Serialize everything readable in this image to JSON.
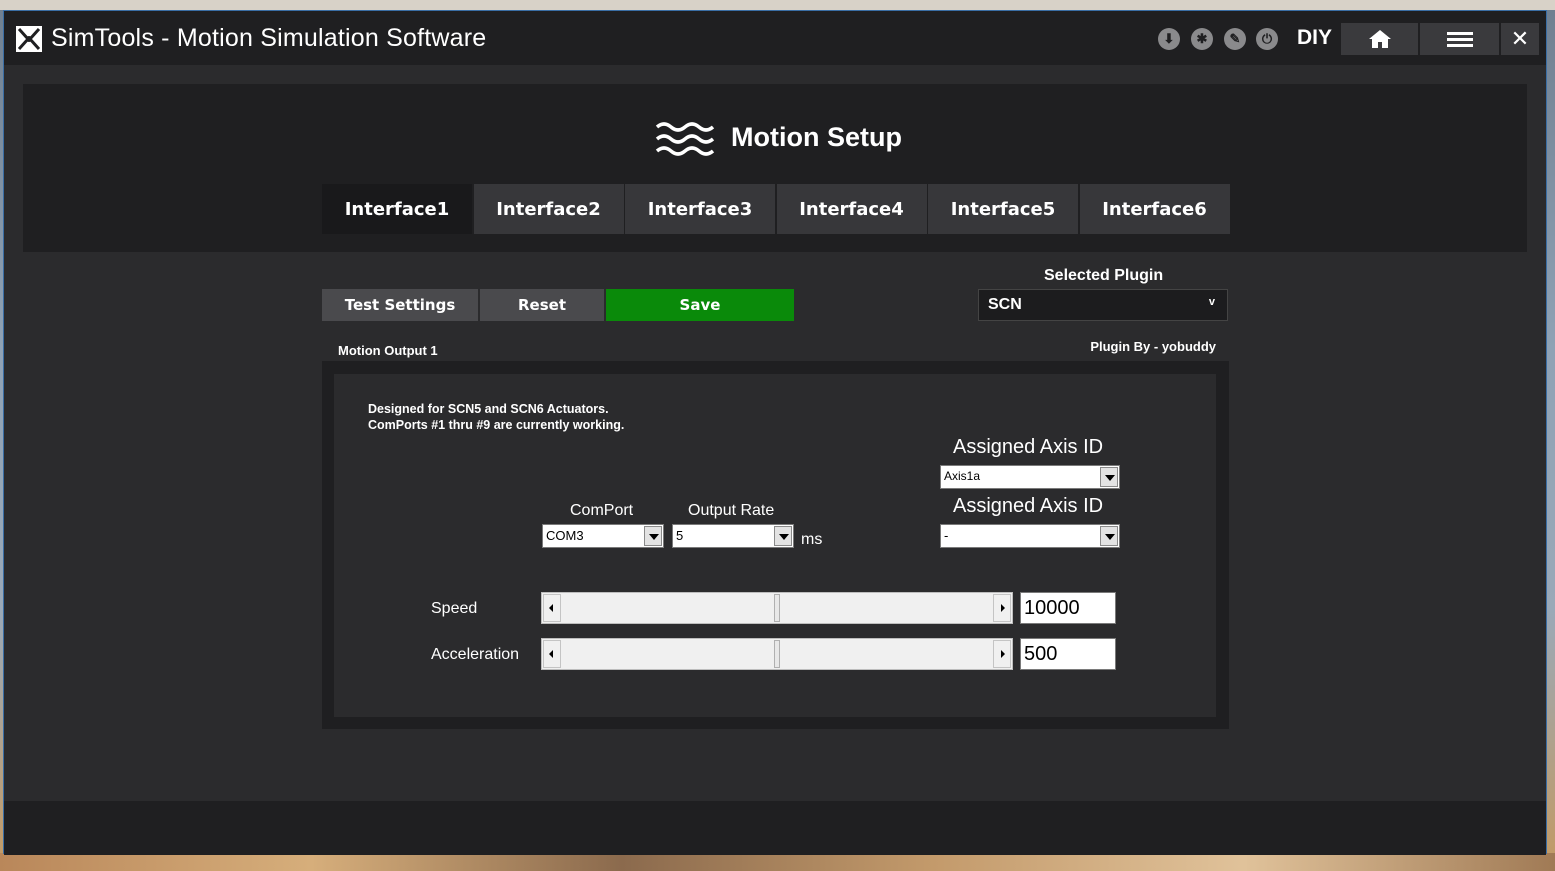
{
  "window": {
    "title": "SimTools - Motion Simulation Software",
    "accent_color": "#3a6ea5"
  },
  "titlebar": {
    "icons": [
      "download-icon",
      "settings-icon",
      "edit-icon",
      "power-icon"
    ],
    "diy_label": "DIY",
    "home_icon": "home-icon",
    "menu_icon": "menu-icon",
    "close_label": "✕"
  },
  "header": {
    "icon": "wave-icon",
    "title": "Motion Setup"
  },
  "tabs": [
    {
      "label": "Interface1",
      "active": true
    },
    {
      "label": "Interface2",
      "active": false
    },
    {
      "label": "Interface3",
      "active": false
    },
    {
      "label": "Interface4",
      "active": false
    },
    {
      "label": "Interface5",
      "active": false
    },
    {
      "label": "Interface6",
      "active": false
    }
  ],
  "toolbar": {
    "test_label": "Test Settings",
    "reset_label": "Reset",
    "save_label": "Save",
    "save_color": "#0a8a0a"
  },
  "plugin": {
    "selected_label": "Selected Plugin",
    "selected_value": "SCN",
    "author_label": "Plugin By - yobuddy"
  },
  "output": {
    "section_label": "Motion Output 1",
    "description_line1": "Designed for SCN5 and SCN6 Actuators.",
    "description_line2": "ComPorts #1 thru #9 are currently working.",
    "comport_label": "ComPort",
    "comport_value": "COM3",
    "rate_label": "Output Rate",
    "rate_value": "5",
    "rate_unit": "ms",
    "axis1_label": "Assigned Axis ID",
    "axis1_value": "Axis1a",
    "axis2_label": "Assigned Axis ID",
    "axis2_value": "-",
    "speed_label": "Speed",
    "speed_value": "10000",
    "speed_fraction": 0.5,
    "accel_label": "Acceleration",
    "accel_value": "500",
    "accel_fraction": 0.5
  }
}
